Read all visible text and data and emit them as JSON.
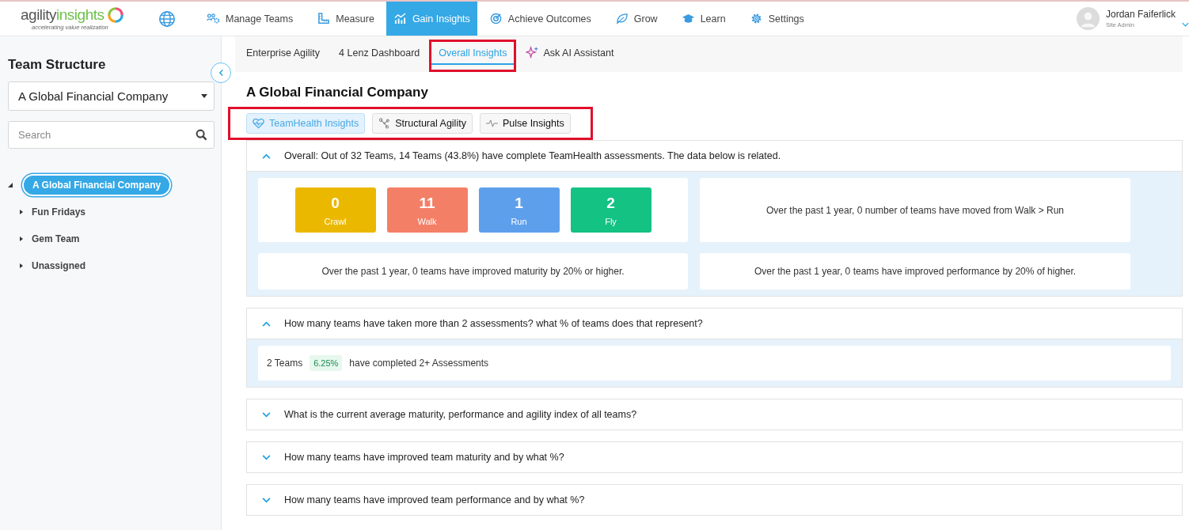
{
  "nav": {
    "logo": {
      "word1": "agility",
      "word2": "insights",
      "tagline": "accelerating value realization"
    },
    "items": [
      {
        "label": "Manage Teams",
        "selected": false
      },
      {
        "label": "Measure",
        "selected": false
      },
      {
        "label": "Gain Insights",
        "selected": true
      },
      {
        "label": "Achieve Outcomes",
        "selected": false
      },
      {
        "label": "Grow",
        "selected": false
      },
      {
        "label": "Learn",
        "selected": false
      },
      {
        "label": "Settings",
        "selected": false
      }
    ],
    "user": {
      "name": "Jordan Faiferlick",
      "role": "Site Admin"
    }
  },
  "sidebar": {
    "title": "Team Structure",
    "company_select": {
      "value": "A Global Financial Company"
    },
    "search": {
      "placeholder": "Search"
    },
    "tree": [
      {
        "label": "A Global Financial Company",
        "selected": true,
        "expanded": true,
        "children": [
          {
            "label": "Fun Fridays",
            "selected": false,
            "expanded": false
          },
          {
            "label": "Gem Team",
            "selected": false,
            "expanded": false
          },
          {
            "label": "Unassigned",
            "selected": false,
            "expanded": false
          }
        ]
      }
    ]
  },
  "tabs": [
    {
      "kind": "plain",
      "label": "Enterprise Agility",
      "selected": false,
      "highlighted": false
    },
    {
      "kind": "plain",
      "label": "4 Lenz Dashboard",
      "selected": false,
      "highlighted": false
    },
    {
      "kind": "plain",
      "label": "Overall Insights",
      "selected": true,
      "highlighted": true
    },
    {
      "kind": "ai",
      "label": "Ask AI Assistant",
      "selected": false,
      "highlighted": false
    }
  ],
  "title": "A Global Financial Company",
  "insight_tabs": {
    "highlighted": true,
    "items": [
      {
        "label": "TeamHealth Insights",
        "selected": true
      },
      {
        "label": "Structural Agility",
        "selected": false
      },
      {
        "label": "Pulse Insights",
        "selected": false
      }
    ]
  },
  "accordions": [
    {
      "kind": "levels",
      "question": "Overall: Out of 32 Teams, 14 Teams (43.8%) have complete TeamHealth assessments. The data below is related.",
      "expanded": true,
      "levels": [
        {
          "count": "0",
          "label": "Crawl",
          "color": "#ebb800"
        },
        {
          "count": "11",
          "label": "Walk",
          "color": "#f47f67"
        },
        {
          "count": "1",
          "label": "Run",
          "color": "#5e9fec"
        },
        {
          "count": "2",
          "label": "Fly",
          "color": "#14c283"
        }
      ],
      "facts": [
        "Over the past 1 year, 0 number of teams have moved from Walk > Run",
        "Over the past 1 year, 0 teams have improved maturity by 20% or higher.",
        "Over the past 1 year, 0 teams have improved performance by 20% of higher."
      ]
    },
    {
      "kind": "summary",
      "question": "How many teams have taken more than 2 assessments? what % of teams does that represent?",
      "expanded": true,
      "teams": "2 Teams",
      "badge": "6.25%",
      "text": "have completed 2+ Assessments"
    },
    {
      "question": "What is the current average maturity, performance and agility index of all teams?",
      "expanded": false
    },
    {
      "question": "How many teams have improved team maturity and by what %?",
      "expanded": false
    },
    {
      "question": "How many teams have improved team performance and by what %?",
      "expanded": false
    }
  ]
}
